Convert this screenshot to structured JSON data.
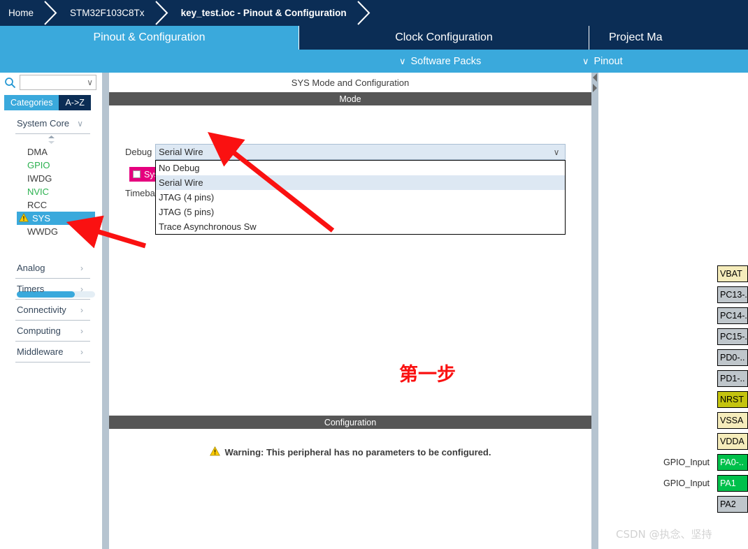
{
  "breadcrumb": {
    "items": [
      {
        "label": "Home",
        "bold": false
      },
      {
        "label": "STM32F103C8Tx",
        "bold": false
      },
      {
        "label": "key_test.ioc - Pinout & Configuration",
        "bold": true
      }
    ]
  },
  "tabs": [
    {
      "label": "Pinout & Configuration",
      "active": true
    },
    {
      "label": "Clock Configuration",
      "active": false
    },
    {
      "label": "Project Ma",
      "active": false
    }
  ],
  "subbar": {
    "software_packs": "Software Packs",
    "pinout": "Pinout",
    "chevron": "∨"
  },
  "sidebar": {
    "search": {
      "value": "",
      "placeholder": "",
      "icon": "search-icon",
      "chevron": "∨"
    },
    "pilltabs": [
      {
        "label": "Categories",
        "selected": true
      },
      {
        "label": "A->Z",
        "selected": false
      }
    ],
    "system_core": {
      "label": "System Core",
      "chevron": "∨",
      "peripherals": [
        {
          "label": "DMA",
          "state": "normal"
        },
        {
          "label": "GPIO",
          "state": "configured"
        },
        {
          "label": "IWDG",
          "state": "normal"
        },
        {
          "label": "NVIC",
          "state": "configured"
        },
        {
          "label": "RCC",
          "state": "normal"
        },
        {
          "label": "SYS",
          "state": "selected-warning"
        },
        {
          "label": "WWDG",
          "state": "normal"
        }
      ]
    },
    "categories": [
      {
        "label": "Analog",
        "arrow": "›"
      },
      {
        "label": "Timers",
        "arrow": "›"
      },
      {
        "label": "Connectivity",
        "arrow": "›"
      },
      {
        "label": "Computing",
        "arrow": "›"
      },
      {
        "label": "Middleware",
        "arrow": "›"
      }
    ]
  },
  "center": {
    "panel_title": "SYS Mode and Configuration",
    "mode_band": "Mode",
    "debug_label": "Debug",
    "debug_value": "Serial Wire",
    "combo_chevron": "∨",
    "sys_checkbox_label": "Sys",
    "sys_checkbox_checked": false,
    "timebase_label": "Timeba",
    "dropdown_options": [
      {
        "label": "No Debug",
        "highlighted": false
      },
      {
        "label": "Serial Wire",
        "highlighted": true
      },
      {
        "label": "JTAG (4 pins)",
        "highlighted": false
      },
      {
        "label": "JTAG (5 pins)",
        "highlighted": false
      },
      {
        "label": "Trace Asynchronous Sw",
        "highlighted": false
      }
    ],
    "annotation_step": "第一步",
    "configuration_band": "Configuration",
    "warning_text": "Warning: This peripheral has no parameters to be configured."
  },
  "pins": [
    {
      "name": "VBAT",
      "signal": "",
      "color": "#f5ecbb"
    },
    {
      "name": "PC13-..",
      "signal": "",
      "color": "#bfc6cb"
    },
    {
      "name": "PC14-..",
      "signal": "",
      "color": "#bfc6cb"
    },
    {
      "name": "PC15-..",
      "signal": "",
      "color": "#bfc6cb"
    },
    {
      "name": "PD0-..",
      "signal": "",
      "color": "#bfc6cb"
    },
    {
      "name": "PD1-..",
      "signal": "",
      "color": "#bfc6cb"
    },
    {
      "name": "NRST",
      "signal": "",
      "color": "#c4c40f"
    },
    {
      "name": "VSSA",
      "signal": "",
      "color": "#f5ecbb"
    },
    {
      "name": "VDDA",
      "signal": "",
      "color": "#f5ecbb"
    },
    {
      "name": "PA0-..",
      "signal": "GPIO_Input",
      "color": "#00c04b"
    },
    {
      "name": "PA1",
      "signal": "GPIO_Input",
      "color": "#00c04b"
    },
    {
      "name": "PA2",
      "signal": "",
      "color": "#bfc6cb"
    }
  ],
  "watermark": "CSDN @执念、坚持",
  "colors": {
    "navy": "#0b2d55",
    "accent_blue": "#3aa9dc",
    "band_gray": "#565656",
    "magenta": "#e5007e",
    "annotation_red": "#fa1111",
    "splitter": "#b6c4d0"
  }
}
